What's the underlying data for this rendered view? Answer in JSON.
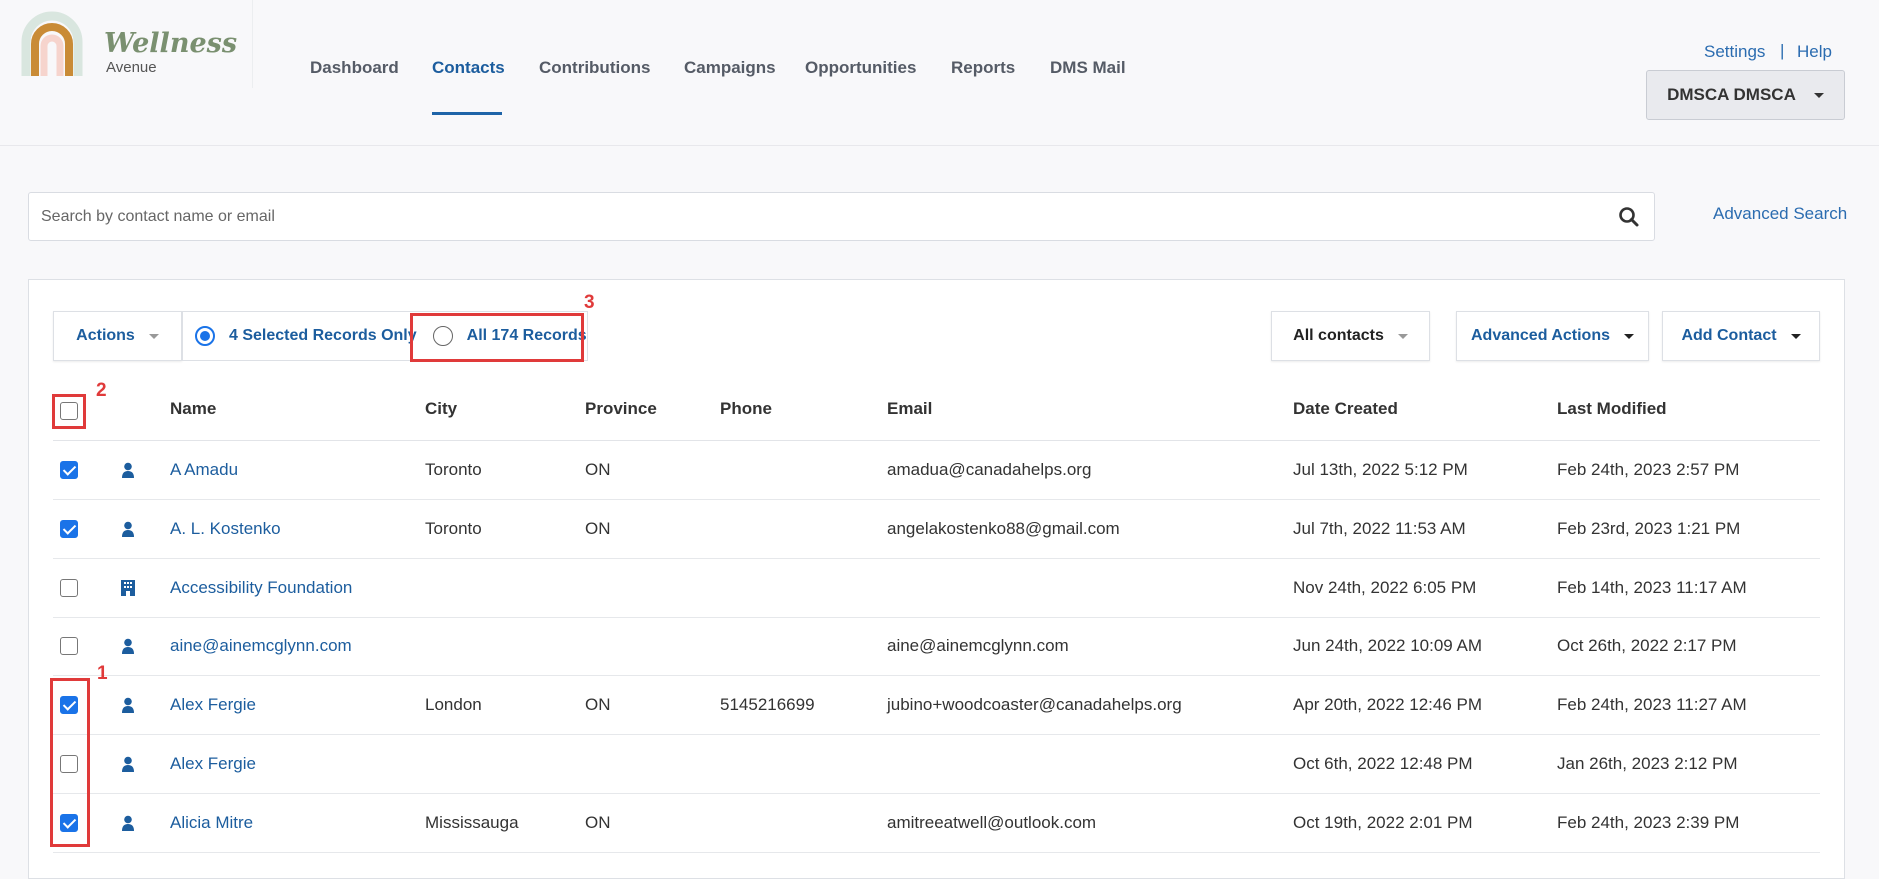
{
  "logo": {
    "brand": "Wellness",
    "sub": "Avenue"
  },
  "nav": [
    {
      "label": "Dashboard"
    },
    {
      "label": "Contacts",
      "active": true
    },
    {
      "label": "Contributions"
    },
    {
      "label": "Campaigns"
    },
    {
      "label": "Opportunities"
    },
    {
      "label": "Reports"
    },
    {
      "label": "DMS Mail"
    }
  ],
  "top_links": {
    "settings": "Settings",
    "separator": "|",
    "help": "Help"
  },
  "user_menu": {
    "label": "DMSCA DMSCA"
  },
  "search": {
    "placeholder": "Search by contact name or email",
    "value": "",
    "advanced_label": "Advanced Search"
  },
  "toolbar": {
    "actions": "Actions",
    "selected_only": "4 Selected Records Only",
    "all_records": "All 174 Records",
    "selection_mode": "selected_only",
    "filter": "All contacts",
    "advanced_actions": "Advanced Actions",
    "add_contact": "Add Contact"
  },
  "table": {
    "columns": [
      "Name",
      "City",
      "Province",
      "Phone",
      "Email",
      "Date Created",
      "Last Modified"
    ],
    "select_all_checked": false,
    "rows": [
      {
        "checked": true,
        "type": "person",
        "name": "A Amadu",
        "city": "Toronto",
        "province": "ON",
        "phone": "",
        "email": "amadua@canadahelps.org",
        "created": "Jul 13th, 2022 5:12 PM",
        "modified": "Feb 24th, 2023 2:57 PM"
      },
      {
        "checked": true,
        "type": "person",
        "name": "A. L. Kostenko",
        "city": "Toronto",
        "province": "ON",
        "phone": "",
        "email": "angelakostenko88@gmail.com",
        "created": "Jul 7th, 2022 11:53 AM",
        "modified": "Feb 23rd, 2023 1:21 PM"
      },
      {
        "checked": false,
        "type": "organization",
        "name": "Accessibility Foundation",
        "city": "",
        "province": "",
        "phone": "",
        "email": "",
        "created": "Nov 24th, 2022 6:05 PM",
        "modified": "Feb 14th, 2023 11:17 AM"
      },
      {
        "checked": false,
        "type": "person",
        "name": "aine@ainemcglynn.com",
        "city": "",
        "province": "",
        "phone": "",
        "email": "aine@ainemcglynn.com",
        "created": "Jun 24th, 2022 10:09 AM",
        "modified": "Oct 26th, 2022 2:17 PM"
      },
      {
        "checked": true,
        "type": "person",
        "name": "Alex Fergie",
        "city": "London",
        "province": "ON",
        "phone": "5145216699",
        "email": "jubino+woodcoaster@canadahelps.org",
        "created": "Apr 20th, 2022 12:46 PM",
        "modified": "Feb 24th, 2023 11:27 AM"
      },
      {
        "checked": false,
        "type": "person",
        "name": "Alex Fergie",
        "city": "",
        "province": "",
        "phone": "",
        "email": "",
        "created": "Oct 6th, 2022 12:48 PM",
        "modified": "Jan 26th, 2023 2:12 PM"
      },
      {
        "checked": true,
        "type": "person",
        "name": "Alicia Mitre",
        "city": "Mississauga",
        "province": "ON",
        "phone": "",
        "email": "amitreeatwell@outlook.com",
        "created": "Oct 19th, 2022 2:01 PM",
        "modified": "Feb 24th, 2023 2:39 PM"
      }
    ]
  },
  "annotations": [
    "1",
    "2",
    "3"
  ],
  "colors": {
    "accent": "#1c5d9e",
    "checkbox": "#1a73e8",
    "annotation": "#e03a3a"
  }
}
